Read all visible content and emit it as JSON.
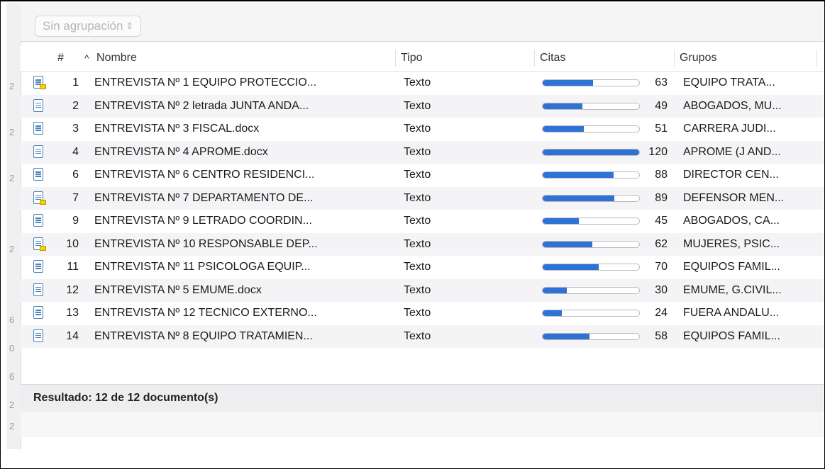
{
  "grouping": {
    "label": "Sin agrupación",
    "chevron": "⌃⌄"
  },
  "left_strip": [
    "2",
    "2",
    "2",
    "2",
    "6",
    "0",
    "6",
    "2",
    "2"
  ],
  "columns": {
    "num": "#",
    "sort_indicator": "^",
    "name": "Nombre",
    "type": "Tipo",
    "citations": "Citas",
    "groups": "Grupos"
  },
  "bar_max": 120,
  "rows": [
    {
      "memo": true,
      "num": "1",
      "name": "ENTREVISTA Nº 1 EQUIPO PROTECCIO...",
      "type": "Texto",
      "citations": 63,
      "groups": "EQUIPO TRATA..."
    },
    {
      "memo": false,
      "num": "2",
      "name": "ENTREVISTA Nº 2 letrada JUNTA ANDA...",
      "type": "Texto",
      "citations": 49,
      "groups": "ABOGADOS, MU..."
    },
    {
      "memo": false,
      "num": "3",
      "name": "ENTREVISTA Nº 3 FISCAL.docx",
      "type": "Texto",
      "citations": 51,
      "groups": "CARRERA JUDI..."
    },
    {
      "memo": false,
      "num": "4",
      "name": "ENTREVISTA Nº 4 APROME.docx",
      "type": "Texto",
      "citations": 120,
      "groups": "APROME (J AND..."
    },
    {
      "memo": false,
      "num": "6",
      "name": "ENTREVISTA Nº 6 CENTRO RESIDENCI...",
      "type": "Texto",
      "citations": 88,
      "groups": "DIRECTOR CEN..."
    },
    {
      "memo": true,
      "num": "7",
      "name": "ENTREVISTA Nº 7 DEPARTAMENTO DE...",
      "type": "Texto",
      "citations": 89,
      "groups": "DEFENSOR MEN..."
    },
    {
      "memo": false,
      "num": "9",
      "name": "ENTREVISTA Nº 9 LETRADO COORDIN...",
      "type": "Texto",
      "citations": 45,
      "groups": "ABOGADOS, CA..."
    },
    {
      "memo": true,
      "num": "10",
      "name": "ENTREVISTA Nº 10 RESPONSABLE DEP...",
      "type": "Texto",
      "citations": 62,
      "groups": "MUJERES, PSIC..."
    },
    {
      "memo": false,
      "num": "11",
      "name": "ENTREVISTA Nº 11 PSICOLOGA EQUIP...",
      "type": "Texto",
      "citations": 70,
      "groups": "EQUIPOS FAMIL..."
    },
    {
      "memo": false,
      "num": "12",
      "name": "ENTREVISTA Nº 5 EMUME.docx",
      "type": "Texto",
      "citations": 30,
      "groups": "EMUME, G.CIVIL..."
    },
    {
      "memo": false,
      "num": "13",
      "name": "ENTREVISTA Nº 12 TECNICO EXTERNO...",
      "type": "Texto",
      "citations": 24,
      "groups": "FUERA ANDALU..."
    },
    {
      "memo": false,
      "num": "14",
      "name": "ENTREVISTA Nº 8 EQUIPO TRATAMIEN...",
      "type": "Texto",
      "citations": 58,
      "groups": "EQUIPOS FAMIL..."
    }
  ],
  "status": {
    "result": "Resultado: 12 de 12 documento(s)"
  },
  "colors": {
    "bar_fill": "#2f72d6",
    "doc_icon": "#4a7fb8",
    "memo": "#f5d300"
  }
}
